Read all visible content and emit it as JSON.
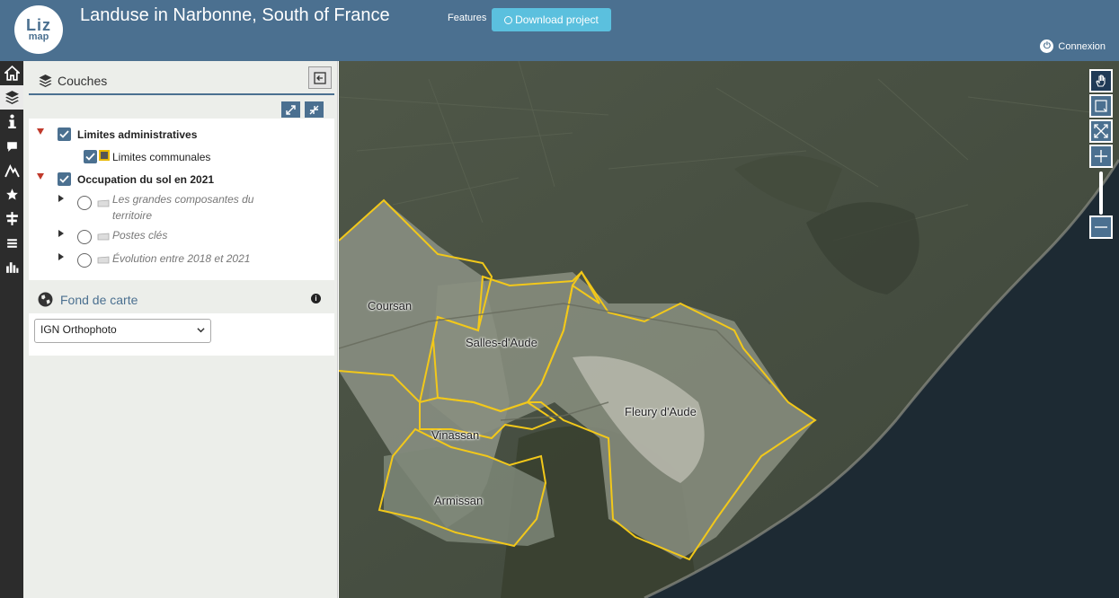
{
  "app": {
    "logo_line1": "Liz",
    "logo_line2": "map",
    "title": "Landuse in Narbonne, South of France",
    "features_label": "Features",
    "download_label": "Download project",
    "connexion_label": "Connexion",
    "brand_color": "#4b7090",
    "accent_color": "#5bc0de"
  },
  "toolbar": {
    "items": [
      {
        "icon": "home-icon",
        "active": false
      },
      {
        "icon": "layers-icon",
        "active": true
      },
      {
        "icon": "info-icon",
        "active": false
      },
      {
        "icon": "comment-icon",
        "active": false
      },
      {
        "icon": "elevation-icon",
        "active": false
      },
      {
        "icon": "star-icon",
        "active": false
      },
      {
        "icon": "signpost-icon",
        "active": false
      },
      {
        "icon": "list-icon",
        "active": false
      },
      {
        "icon": "bar-chart-icon",
        "active": false
      }
    ]
  },
  "layers_panel": {
    "title": "Couches",
    "groups": [
      {
        "label": "Limites administratives",
        "checked": true,
        "children": [
          {
            "label": "Limites communales",
            "checked": true
          }
        ]
      },
      {
        "label": "Occupation du sol en 2021",
        "checked": true,
        "children": [
          {
            "label_line1": "Les grandes composantes du",
            "label_line2": "territoire",
            "checked": false
          },
          {
            "label": "Postes clés",
            "checked": false
          },
          {
            "label": "Évolution entre 2018 et 2021",
            "checked": false
          }
        ]
      }
    ]
  },
  "basemap": {
    "title": "Fond de carte",
    "selected": "IGN Orthophoto"
  },
  "map": {
    "towns": [
      "Coursan",
      "Salles-d'Aude",
      "Fleury d'Aude",
      "Vinassan",
      "Armissan"
    ],
    "boundary_color": "#f2c81a"
  }
}
